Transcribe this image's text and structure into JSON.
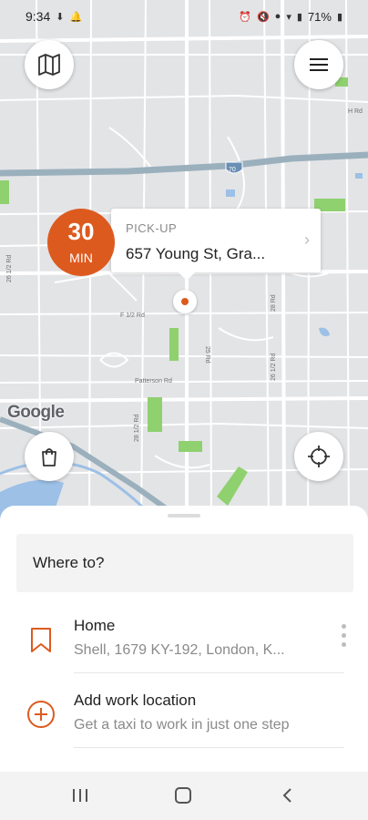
{
  "status_bar": {
    "time": "9:34",
    "battery": "71%"
  },
  "map": {
    "google_logo": "Google",
    "highway_shield": "70",
    "street_labels": [
      "Patterson Rd",
      "F 1/2 Rd",
      "H Rd",
      "26 1/2 Rd",
      "25 Rd",
      "26 1/2 Rd",
      "28 Rd",
      "28 1/2 Rd"
    ]
  },
  "pickup": {
    "eta_value": "30",
    "eta_unit": "MIN",
    "label": "PICK-UP",
    "address": "657 Young St, Gra..."
  },
  "sheet": {
    "search_placeholder": "Where to?",
    "saved_places": [
      {
        "title": "Home",
        "subtitle": "Shell, 1679 KY-192, London, K...",
        "icon": "bookmark-icon"
      },
      {
        "title": "Add work location",
        "subtitle": "Get a taxi to work in just one step",
        "icon": "add-circle-icon"
      }
    ]
  },
  "colors": {
    "accent": "#dd5a1f",
    "map_bg": "#e3e4e6",
    "highway": "#9bb0bd",
    "park": "#8fd06f",
    "water": "#9cc0e6"
  }
}
